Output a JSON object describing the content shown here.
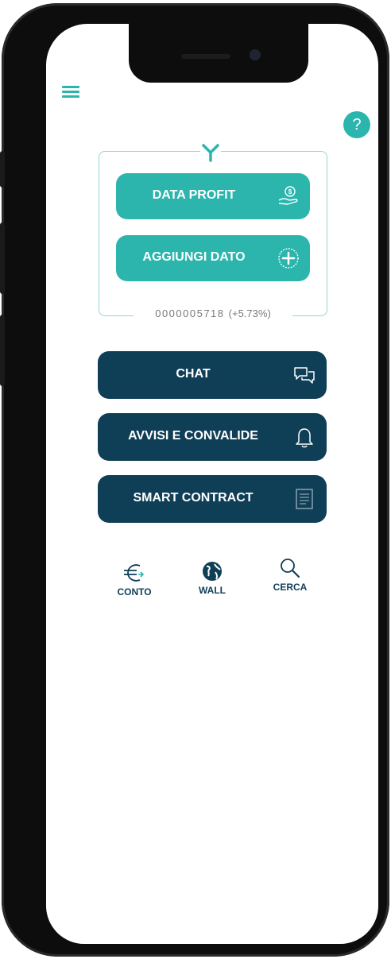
{
  "header": {
    "menu_icon": "hamburger-menu-icon",
    "help_label": "?"
  },
  "panel": {
    "logo_icon": "y-logo-icon",
    "data_profit_label": "DATA PROFIT",
    "data_profit_icon": "hand-coin-icon",
    "add_data_label": "AGGIUNGI DATO",
    "add_data_icon": "plus-circle-icon",
    "counter_value": "0000005718",
    "counter_change": "(+5.73%)"
  },
  "menu": {
    "chat_label": "CHAT",
    "chat_icon": "chat-bubbles-icon",
    "alerts_label": "AVVISI E CONVALIDE",
    "alerts_icon": "bell-icon",
    "contract_label": "SMART CONTRACT",
    "contract_icon": "document-icon"
  },
  "bottom_nav": {
    "account_label": "CONTO",
    "account_icon": "euro-icon",
    "wall_label": "WALL",
    "wall_icon": "globe-icon",
    "search_label": "CERCA",
    "search_icon": "magnifier-icon"
  },
  "colors": {
    "teal": "#2bb5ad",
    "navy": "#0f3e57"
  }
}
